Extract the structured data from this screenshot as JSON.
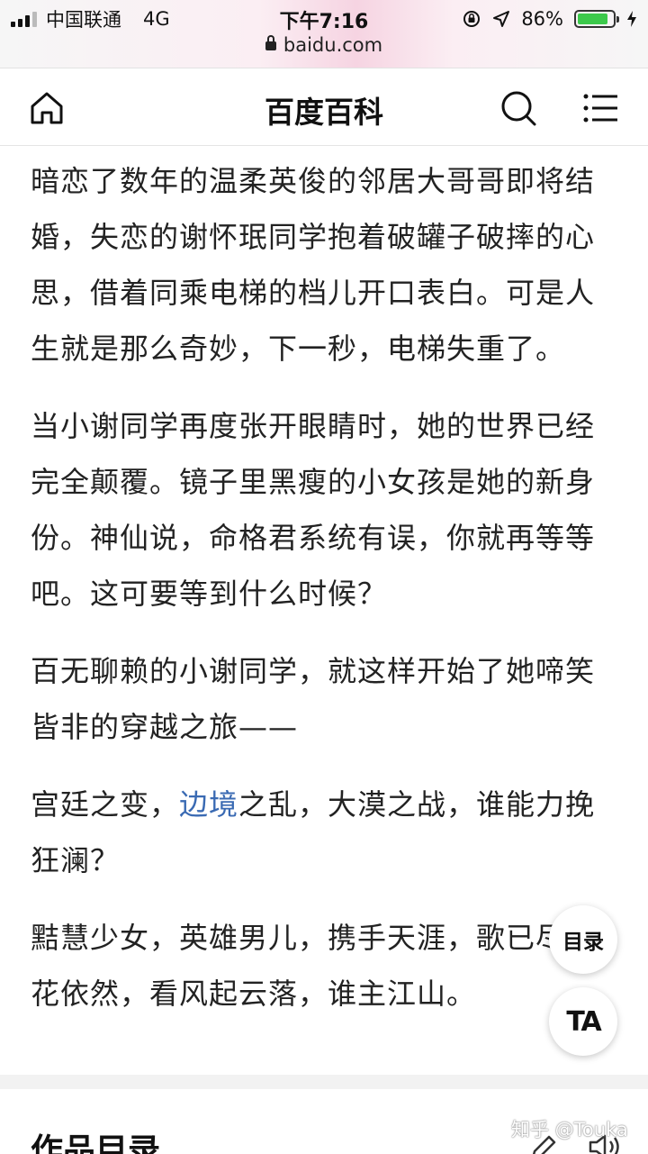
{
  "status_bar": {
    "carrier": "中国联通",
    "network": "4G",
    "time": "下午7:16",
    "url": "baidu.com",
    "battery_percent": "86%",
    "battery_level": 0.86,
    "icons": [
      "signal-icon",
      "lock-icon",
      "rotation-lock-icon",
      "location-icon",
      "battery-icon",
      "charging-icon"
    ]
  },
  "nav": {
    "title": "百度百科",
    "icons": [
      "home-icon",
      "search-icon",
      "menu-icon"
    ]
  },
  "article": {
    "paragraphs": [
      {
        "text": "暗恋了数年的温柔英俊的邻居大哥哥即将结婚，失恋的谢怀珉同学抱着破罐子破摔的心思，借着同乘电梯的档儿开口表白。可是人生就是那么奇妙，下一秒，电梯失重了。"
      },
      {
        "text": "当小谢同学再度张开眼睛时，她的世界已经完全颠覆。镜子里黑瘦的小女孩是她的新身份。神仙说，命格君系统有误，你就再等等吧。这可要等到什么时候？"
      },
      {
        "text": "百无聊赖的小谢同学，就这样开始了她啼笑皆非的穿越之旅——"
      },
      {
        "before": "宫廷之变，",
        "link": "边境",
        "after": "之乱，大漠之战，谁能力挽狂澜？"
      },
      {
        "text": "黠慧少女，英雄男儿，携手天涯，歌已尽，花依然，看风起云落，谁主江山。"
      }
    ]
  },
  "section": {
    "title": "作品目录"
  },
  "floating": {
    "toc_label": "目录",
    "ta_label": "TA"
  },
  "watermark": "知乎 @Touka"
}
